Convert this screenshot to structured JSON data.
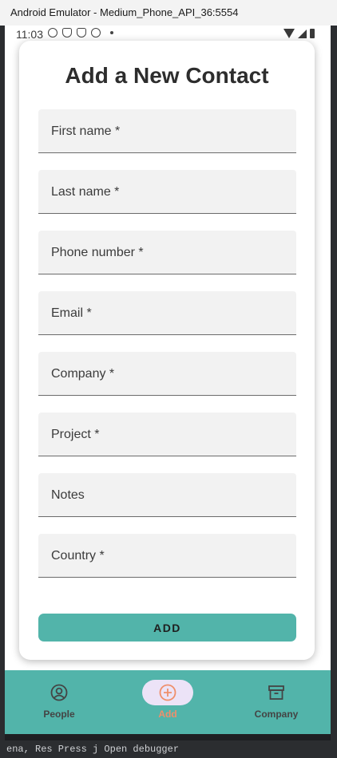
{
  "window": {
    "title": "Android Emulator - Medium_Phone_API_36:5554"
  },
  "ide": {
    "bottom_text": "ena, Res     Press j   Open debugger"
  },
  "statusbar": {
    "time": "11:03"
  },
  "form": {
    "title": "Add a New Contact",
    "fields": [
      {
        "label": "First name *"
      },
      {
        "label": "Last name *"
      },
      {
        "label": "Phone number *"
      },
      {
        "label": "Email *"
      },
      {
        "label": "Company *"
      },
      {
        "label": "Project *"
      },
      {
        "label": "Notes"
      },
      {
        "label": "Country *"
      }
    ],
    "submit_label": "ADD"
  },
  "nav": {
    "items": [
      {
        "label": "People",
        "icon": "person-icon",
        "active": false
      },
      {
        "label": "Add",
        "icon": "add-circle-icon",
        "active": true
      },
      {
        "label": "Company",
        "icon": "archive-icon",
        "active": false
      }
    ]
  },
  "colors": {
    "accent": "#52b4aa",
    "active_nav": "#ef8f6b",
    "active_pill": "#ece3f7"
  }
}
